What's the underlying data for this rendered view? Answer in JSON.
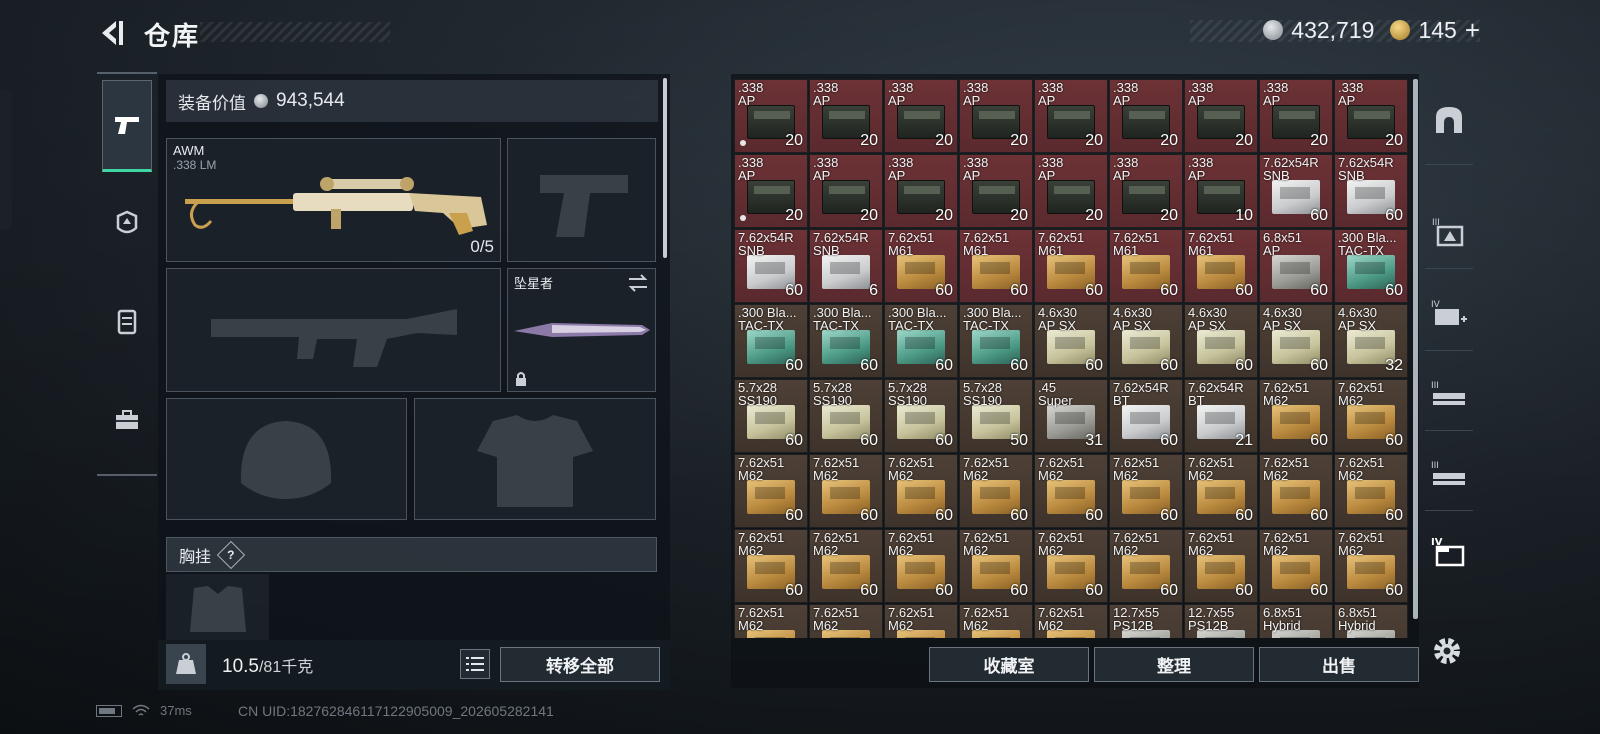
{
  "header": {
    "title": "仓库"
  },
  "currency": {
    "silver": "432,719",
    "gold": "145",
    "gold_plus": "+"
  },
  "loadout": {
    "equipment_value_label": "装备价值",
    "equipment_value": "943,544",
    "primary": {
      "name": "AWM",
      "ammo": ".338 LM",
      "count": "0/5"
    },
    "melee": {
      "name": "坠星者"
    },
    "chest_rig_label": "胸挂",
    "chest_rig_help": "?",
    "weight_value": "10.5",
    "weight_max": "/81千克",
    "transfer_all": "转移全部"
  },
  "stash": {
    "rows": [
      [
        {
          "n": ".338\nAP",
          "c": "20",
          "bg": "red",
          "b": "ammo-can",
          "dot": true
        },
        {
          "n": ".338\nAP",
          "c": "20",
          "bg": "red",
          "b": "ammo-can"
        },
        {
          "n": ".338\nAP",
          "c": "20",
          "bg": "red",
          "b": "ammo-can"
        },
        {
          "n": ".338\nAP",
          "c": "20",
          "bg": "red",
          "b": "ammo-can"
        },
        {
          "n": ".338\nAP",
          "c": "20",
          "bg": "red",
          "b": "ammo-can"
        },
        {
          "n": ".338\nAP",
          "c": "20",
          "bg": "red",
          "b": "ammo-can"
        },
        {
          "n": ".338\nAP",
          "c": "20",
          "bg": "red",
          "b": "ammo-can"
        },
        {
          "n": ".338\nAP",
          "c": "20",
          "bg": "red",
          "b": "ammo-can"
        },
        {
          "n": ".338\nAP",
          "c": "20",
          "bg": "red",
          "b": "ammo-can"
        }
      ],
      [
        {
          "n": ".338\nAP",
          "c": "20",
          "bg": "red",
          "b": "ammo-can",
          "dot": true
        },
        {
          "n": ".338\nAP",
          "c": "20",
          "bg": "red",
          "b": "ammo-can"
        },
        {
          "n": ".338\nAP",
          "c": "20",
          "bg": "red",
          "b": "ammo-can"
        },
        {
          "n": ".338\nAP",
          "c": "20",
          "bg": "red",
          "b": "ammo-can"
        },
        {
          "n": ".338\nAP",
          "c": "20",
          "bg": "red",
          "b": "ammo-can"
        },
        {
          "n": ".338\nAP",
          "c": "20",
          "bg": "red",
          "b": "ammo-can"
        },
        {
          "n": ".338\nAP",
          "c": "10",
          "bg": "red",
          "b": "ammo-can"
        },
        {
          "n": "7.62x54R\nSNB",
          "c": "60",
          "bg": "red",
          "b": "white"
        },
        {
          "n": "7.62x54R\nSNB",
          "c": "60",
          "bg": "red",
          "b": "white"
        }
      ],
      [
        {
          "n": "7.62x54R\nSNB",
          "c": "60",
          "bg": "red",
          "b": "white"
        },
        {
          "n": "7.62x54R\nSNB",
          "c": "6",
          "bg": "red",
          "b": "white"
        },
        {
          "n": "7.62x51\nM61",
          "c": "60",
          "bg": "red",
          "b": "gold"
        },
        {
          "n": "7.62x51\nM61",
          "c": "60",
          "bg": "red",
          "b": "gold"
        },
        {
          "n": "7.62x51\nM61",
          "c": "60",
          "bg": "red",
          "b": "gold"
        },
        {
          "n": "7.62x51\nM61",
          "c": "60",
          "bg": "red",
          "b": "gold"
        },
        {
          "n": "7.62x51\nM61",
          "c": "60",
          "bg": "red",
          "b": "gold"
        },
        {
          "n": "6.8x51\nAP",
          "c": "60",
          "bg": "red",
          "b": "grey"
        },
        {
          "n": ".300 Bla...\nTAC-TX",
          "c": "60",
          "bg": "red",
          "b": "teal"
        }
      ],
      [
        {
          "n": ".300 Bla...\nTAC-TX",
          "c": "60",
          "bg": "brown",
          "b": "teal"
        },
        {
          "n": ".300 Bla...\nTAC-TX",
          "c": "60",
          "bg": "brown",
          "b": "teal"
        },
        {
          "n": ".300 Bla...\nTAC-TX",
          "c": "60",
          "bg": "brown",
          "b": "teal"
        },
        {
          "n": ".300 Bla...\nTAC-TX",
          "c": "60",
          "bg": "brown",
          "b": "teal"
        },
        {
          "n": "4.6x30\nAP SX",
          "c": "60",
          "bg": "brown",
          "b": "cream"
        },
        {
          "n": "4.6x30\nAP SX",
          "c": "60",
          "bg": "brown",
          "b": "cream"
        },
        {
          "n": "4.6x30\nAP SX",
          "c": "60",
          "bg": "brown",
          "b": "cream"
        },
        {
          "n": "4.6x30\nAP SX",
          "c": "60",
          "bg": "brown",
          "b": "cream"
        },
        {
          "n": "4.6x30\nAP SX",
          "c": "32",
          "bg": "brown",
          "b": "cream"
        }
      ],
      [
        {
          "n": "5.7x28\nSS190",
          "c": "60",
          "bg": "brown",
          "b": "cream"
        },
        {
          "n": "5.7x28\nSS190",
          "c": "60",
          "bg": "brown",
          "b": "cream"
        },
        {
          "n": "5.7x28\nSS190",
          "c": "60",
          "bg": "brown",
          "b": "cream"
        },
        {
          "n": "5.7x28\nSS190",
          "c": "50",
          "bg": "brown",
          "b": "cream"
        },
        {
          "n": ".45\nSuper",
          "c": "31",
          "bg": "brown",
          "b": "grey"
        },
        {
          "n": "7.62x54R\nBT",
          "c": "60",
          "bg": "brown",
          "b": "white"
        },
        {
          "n": "7.62x54R\nBT",
          "c": "21",
          "bg": "brown",
          "b": "white"
        },
        {
          "n": "7.62x51\nM62",
          "c": "60",
          "bg": "brown",
          "b": "gold"
        },
        {
          "n": "7.62x51\nM62",
          "c": "60",
          "bg": "brown",
          "b": "gold"
        }
      ],
      [
        {
          "n": "7.62x51\nM62",
          "c": "60",
          "bg": "brown",
          "b": "gold"
        },
        {
          "n": "7.62x51\nM62",
          "c": "60",
          "bg": "brown",
          "b": "gold"
        },
        {
          "n": "7.62x51\nM62",
          "c": "60",
          "bg": "brown",
          "b": "gold"
        },
        {
          "n": "7.62x51\nM62",
          "c": "60",
          "bg": "brown",
          "b": "gold"
        },
        {
          "n": "7.62x51\nM62",
          "c": "60",
          "bg": "brown",
          "b": "gold"
        },
        {
          "n": "7.62x51\nM62",
          "c": "60",
          "bg": "brown",
          "b": "gold"
        },
        {
          "n": "7.62x51\nM62",
          "c": "60",
          "bg": "brown",
          "b": "gold"
        },
        {
          "n": "7.62x51\nM62",
          "c": "60",
          "bg": "brown",
          "b": "gold"
        },
        {
          "n": "7.62x51\nM62",
          "c": "60",
          "bg": "brown",
          "b": "gold"
        }
      ],
      [
        {
          "n": "7.62x51\nM62",
          "c": "60",
          "bg": "brown",
          "b": "gold"
        },
        {
          "n": "7.62x51\nM62",
          "c": "60",
          "bg": "brown",
          "b": "gold"
        },
        {
          "n": "7.62x51\nM62",
          "c": "60",
          "bg": "brown",
          "b": "gold"
        },
        {
          "n": "7.62x51\nM62",
          "c": "60",
          "bg": "brown",
          "b": "gold"
        },
        {
          "n": "7.62x51\nM62",
          "c": "60",
          "bg": "brown",
          "b": "gold"
        },
        {
          "n": "7.62x51\nM62",
          "c": "60",
          "bg": "brown",
          "b": "gold"
        },
        {
          "n": "7.62x51\nM62",
          "c": "60",
          "bg": "brown",
          "b": "gold"
        },
        {
          "n": "7.62x51\nM62",
          "c": "60",
          "bg": "brown",
          "b": "gold"
        },
        {
          "n": "7.62x51\nM62",
          "c": "60",
          "bg": "brown",
          "b": "gold"
        }
      ],
      [
        {
          "n": "7.62x51\nM62",
          "c": "",
          "bg": "brown",
          "b": "gold"
        },
        {
          "n": "7.62x51\nM62",
          "c": "",
          "bg": "brown",
          "b": "gold"
        },
        {
          "n": "7.62x51\nM62",
          "c": "",
          "bg": "brown",
          "b": "gold"
        },
        {
          "n": "7.62x51\nM62",
          "c": "",
          "bg": "brown",
          "b": "gold"
        },
        {
          "n": "7.62x51\nM62",
          "c": "",
          "bg": "brown",
          "b": "gold"
        },
        {
          "n": "12.7x55\nPS12B",
          "c": "",
          "bg": "brown",
          "b": "grey"
        },
        {
          "n": "12.7x55\nPS12B",
          "c": "",
          "bg": "brown",
          "b": "grey"
        },
        {
          "n": "6.8x51\nHybrid",
          "c": "",
          "bg": "brown",
          "b": "grey"
        },
        {
          "n": "6.8x51\nHybrid",
          "c": "",
          "bg": "brown",
          "b": "grey"
        }
      ]
    ],
    "buttons": {
      "collection": "收藏室",
      "organize": "整理",
      "sell": "出售"
    }
  },
  "status": {
    "ping": "37ms",
    "uid": "CN UID:1827628461171229050​09_202605282141"
  }
}
